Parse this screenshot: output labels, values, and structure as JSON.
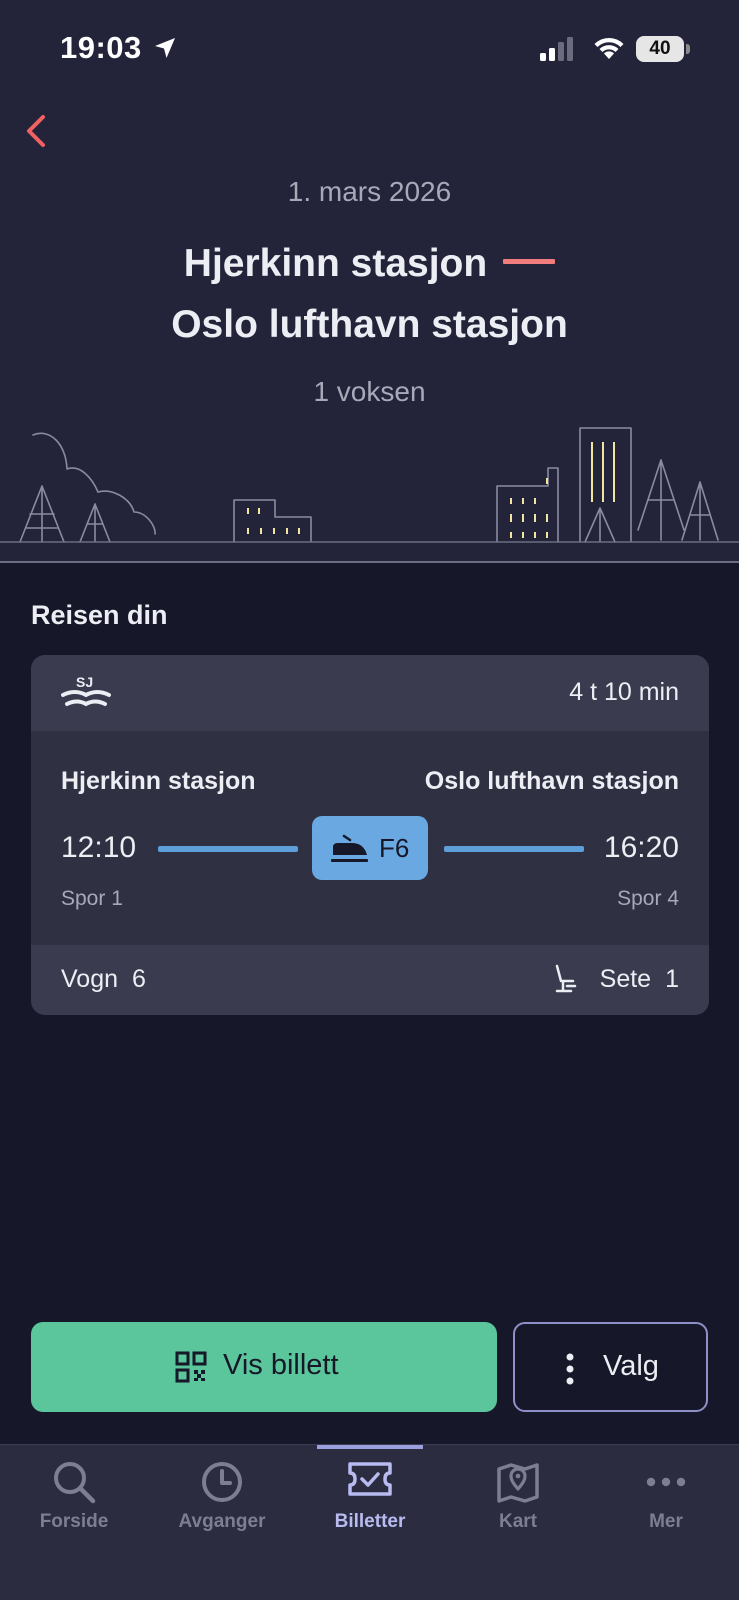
{
  "status_bar": {
    "time": "19:03",
    "battery": "40"
  },
  "header": {
    "date": "1. mars 2026",
    "from": "Hjerkinn stasjon",
    "to": "Oslo lufthavn stasjon",
    "passengers": "1 voksen"
  },
  "journey": {
    "section_title": "Reisen din",
    "operator_logo": "SJ",
    "duration": "4 t 10 min",
    "from_station": "Hjerkinn stasjon",
    "to_station": "Oslo lufthavn stasjon",
    "departure_time": "12:10",
    "arrival_time": "16:20",
    "line": "F6",
    "departure_track": "Spor 1",
    "arrival_track": "Spor 4",
    "coach_label": "Vogn",
    "coach": "6",
    "seat_label": "Sete",
    "seat": "1"
  },
  "actions": {
    "show_ticket": "Vis billett",
    "options": "Valg"
  },
  "tabs": [
    {
      "label": "Forside",
      "icon": "search-icon"
    },
    {
      "label": "Avganger",
      "icon": "clock-icon"
    },
    {
      "label": "Billetter",
      "icon": "ticket-icon",
      "active": true
    },
    {
      "label": "Kart",
      "icon": "map-icon"
    },
    {
      "label": "Mer",
      "icon": "more-icon"
    }
  ],
  "colors": {
    "background": "#161728",
    "header": "#23243a",
    "accent_red": "#f07c7c",
    "route_blue": "#5e9fd9",
    "primary_green": "#5bc69b",
    "options_border": "#8f90c8",
    "tab_active": "#b8bbf0"
  }
}
